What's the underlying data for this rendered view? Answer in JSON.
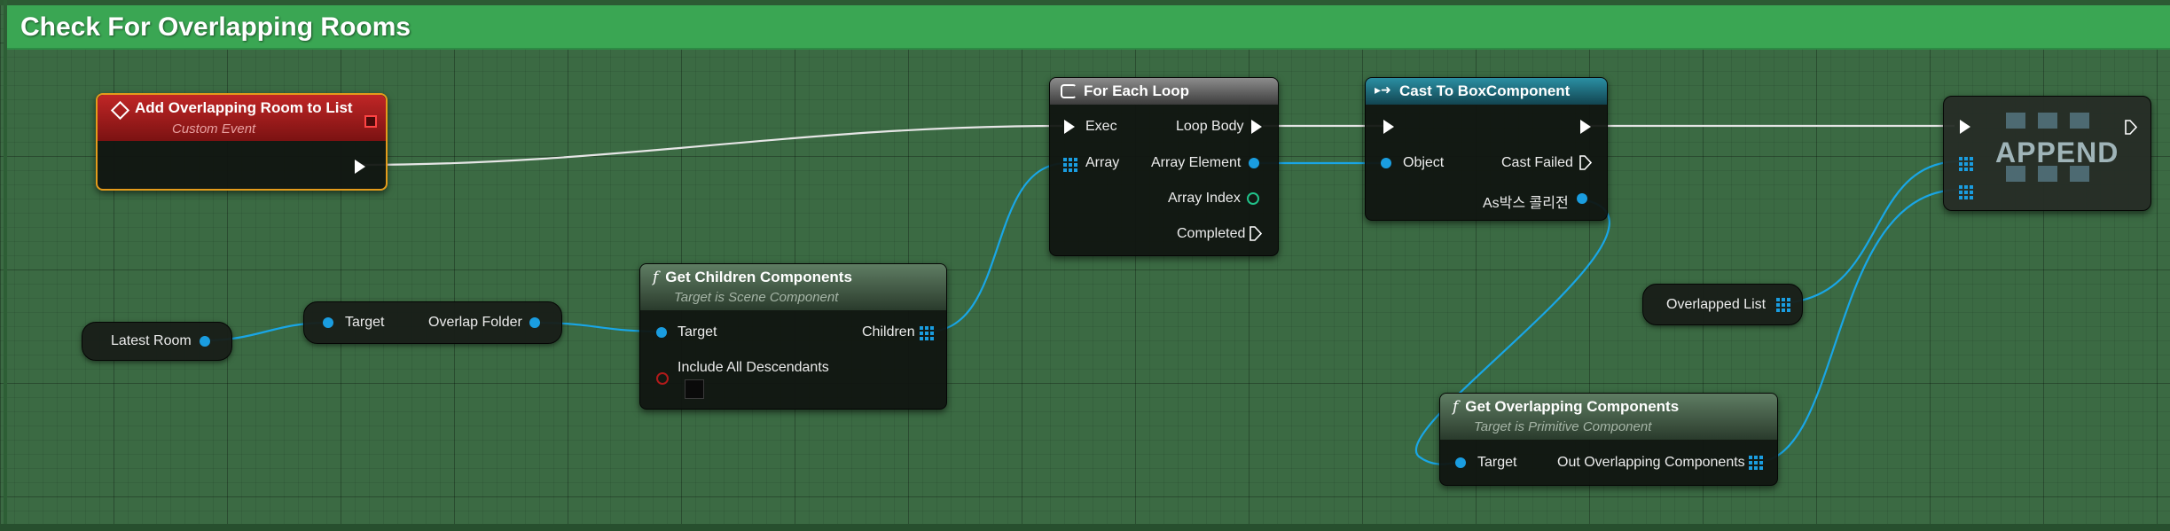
{
  "graph": {
    "comment_title": "Check For Overlapping Rooms"
  },
  "colors": {
    "comment": "#3aa653",
    "event_header": "#a11b1b",
    "event_border": "#e49b1b",
    "data_pin": "#1a9de0",
    "wire_exec": "#e6e6e6",
    "wire_data": "#19a6e6"
  },
  "nodes": {
    "custom_event": {
      "title": "Add Overlapping Room to List",
      "subtitle": "Custom Event",
      "icon": "event-diamond-icon"
    },
    "latest_room": {
      "label": "Latest Room"
    },
    "overlap_folder": {
      "target": "Target",
      "output": "Overlap Folder"
    },
    "get_children": {
      "title": "Get Children Components",
      "subtitle": "Target is Scene Component",
      "in_target": "Target",
      "in_include": "Include All Descendants",
      "out_children": "Children"
    },
    "for_each": {
      "title": "For Each Loop",
      "icon": "loop-icon",
      "in_exec": "Exec",
      "in_array": "Array",
      "out_loop_body": "Loop Body",
      "out_array_element": "Array Element",
      "out_array_index": "Array Index",
      "out_completed": "Completed"
    },
    "cast": {
      "title": "Cast To BoxComponent",
      "icon": "cast-arrow-icon",
      "in_object": "Object",
      "out_cast_failed": "Cast Failed",
      "out_as": "As박스 콜리전"
    },
    "overlapped_list": {
      "label": "Overlapped List"
    },
    "get_overlapping": {
      "title": "Get Overlapping Components",
      "subtitle": "Target is Primitive Component",
      "in_target": "Target",
      "out_components": "Out Overlapping Components"
    },
    "append": {
      "label": "APPEND"
    }
  }
}
